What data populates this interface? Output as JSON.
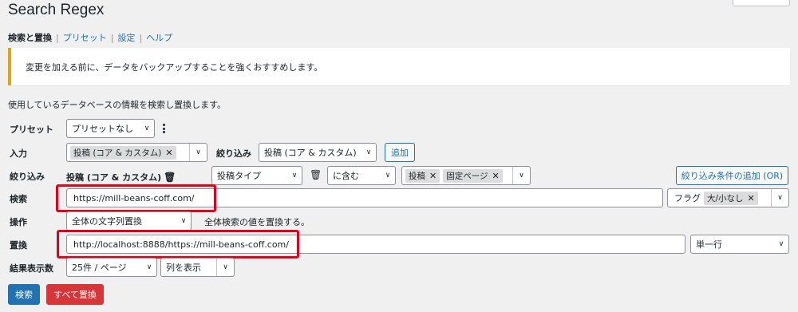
{
  "page": {
    "title": "Search Regex"
  },
  "nav": {
    "current": "検索と置換",
    "links": [
      "プリセット",
      "設定",
      "ヘルプ"
    ]
  },
  "notice": {
    "text": "変更を加える前に、データをバックアップすることを強くおすすめします。"
  },
  "description": "使用しているデータベースの情報を検索し置換します。",
  "labels": {
    "preset": "プリセット",
    "source": "入力",
    "filter": "絞り込み",
    "search": "検索",
    "action": "操作",
    "replace": "置換",
    "results": "結果表示数"
  },
  "preset": {
    "selected": "プリセットなし"
  },
  "source": {
    "tag": "投稿 (コア & カスタム)",
    "filter_label": "絞り込み",
    "filter_selected": "投稿 (コア & カスタム)",
    "add_button": "追加"
  },
  "filter_row": {
    "group_label": "投稿 (コア & カスタム)",
    "column_selected": "投稿タイプ",
    "operator_selected": "に含む",
    "value_tags": [
      "投稿",
      "固定ページ"
    ],
    "add_or_button": "絞り込み条件の追加 (OR)"
  },
  "search": {
    "value": "https://mill-beans-coff.com/",
    "flag_label": "フラグ",
    "flag_tag": "大/小なし"
  },
  "action": {
    "selected": "全体の文字列置換",
    "note": "全体検索の値を置換する。"
  },
  "replace": {
    "value": "http://localhost:8888/https://mill-beans-coff.com/",
    "mode_selected": "単一行"
  },
  "results": {
    "per_page": "25件 / ページ",
    "columns": "列を表示"
  },
  "buttons": {
    "search": "検索",
    "replace_all": "すべて置換"
  },
  "colors": {
    "primary": "#2271b1",
    "danger": "#d63638",
    "notice_warning": "#dba617",
    "highlight": "#e0001b"
  }
}
